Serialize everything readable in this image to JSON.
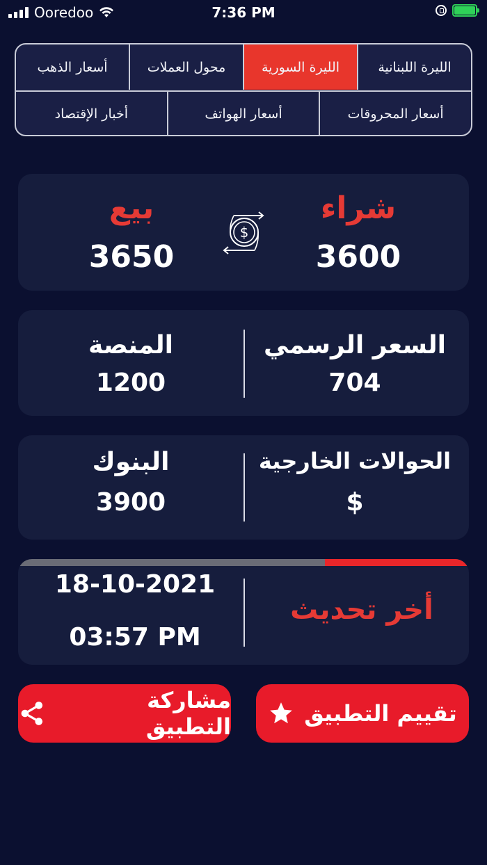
{
  "status_bar": {
    "carrier": "Ooredoo",
    "time": "7:36 PM"
  },
  "tabs": {
    "row1": [
      {
        "label": "الليرة اللبنانية",
        "active": false
      },
      {
        "label": "الليرة السورية",
        "active": true
      },
      {
        "label": "محول العملات",
        "active": false
      },
      {
        "label": "أسعار الذهب",
        "active": false
      }
    ],
    "row2": [
      {
        "label": "أسعار المحروقات",
        "active": false
      },
      {
        "label": "أسعار الهواتف",
        "active": false
      },
      {
        "label": "أخبار الإقتصاد",
        "active": false
      }
    ]
  },
  "rates": {
    "buy_label": "شراء",
    "buy_value": "3600",
    "sell_label": "بيع",
    "sell_value": "3650"
  },
  "official": {
    "official_label": "السعر  الرسمي",
    "official_value": "704",
    "platform_label": "المنصة",
    "platform_value": "1200"
  },
  "transfers": {
    "foreign_label": "الحوالات الخارجية",
    "foreign_value": "$",
    "banks_label": "البنوك",
    "banks_value": "3900"
  },
  "update": {
    "label": "أخر  تحديث",
    "date": "18-10-2021",
    "time": "03:57 PM",
    "progress": 0.32
  },
  "buttons": {
    "rate_label": "تقييم التطبيق",
    "share_label": "مشاركة التطبيق"
  },
  "colors": {
    "background": "#0b1030",
    "card": "#161d3d",
    "accent": "#e8362c",
    "battery": "#2fd158"
  }
}
